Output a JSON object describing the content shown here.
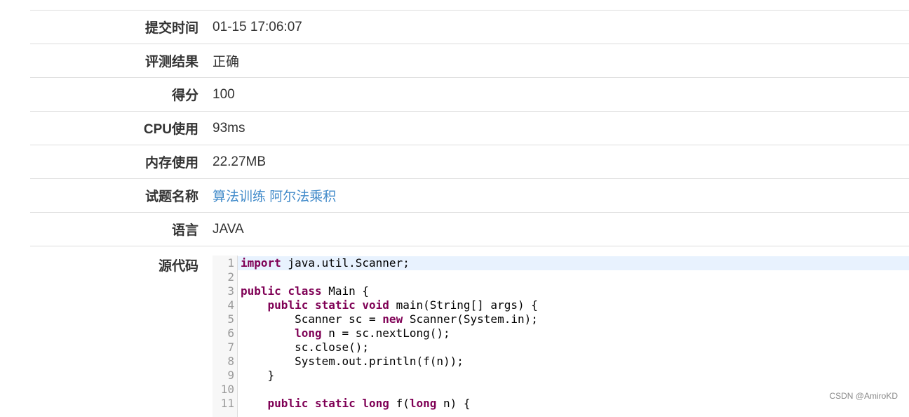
{
  "rows": [
    {
      "label": "提交时间",
      "value": "01-15 17:06:07"
    },
    {
      "label": "评测结果",
      "value": "正确"
    },
    {
      "label": "得分",
      "value": "100"
    },
    {
      "label": "CPU使用",
      "value": "93ms"
    },
    {
      "label": "内存使用",
      "value": "22.27MB"
    },
    {
      "label": "试题名称",
      "value": "算法训练 阿尔法乘积"
    },
    {
      "label": "语言",
      "value": "JAVA"
    }
  ],
  "source": {
    "label": "源代码",
    "line_numbers": [
      "1",
      "2",
      "3",
      "4",
      "5",
      "6",
      "7",
      "8",
      "9",
      "10",
      "11"
    ],
    "lines": [
      "import java.util.Scanner;",
      "",
      "public class Main {",
      "    public static void main(String[] args) {",
      "        Scanner sc = new Scanner(System.in);",
      "        long n = sc.nextLong();",
      "        sc.close();",
      "        System.out.println(f(n));",
      "    }",
      "",
      "    public static long f(long n) {"
    ]
  },
  "watermark": "CSDN @AmiroKD",
  "colors": {
    "link": "#428bca",
    "keyword": "#7f0055",
    "active_line": "#e8f2fe"
  }
}
